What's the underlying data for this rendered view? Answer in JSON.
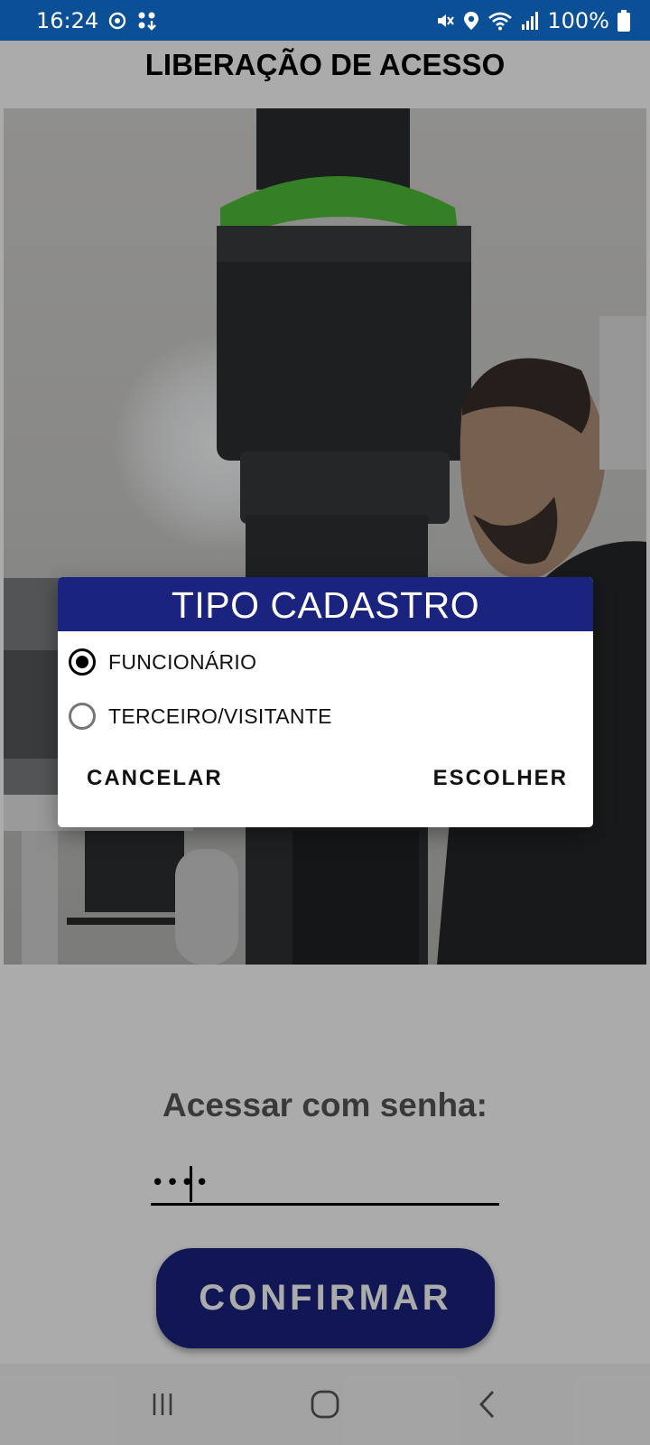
{
  "status_bar": {
    "time": "16:24",
    "battery_text": "100%",
    "icons": [
      "sync-icon",
      "apps-download-icon",
      "mute-icon",
      "location-icon",
      "wifi-icon",
      "signal-icon",
      "battery-icon"
    ]
  },
  "page": {
    "title": "LIBERAÇÃO DE ACESSO"
  },
  "camera": {
    "content": "live-camera-preview"
  },
  "password": {
    "label": "Acessar com senha:",
    "value": "••••"
  },
  "confirm_button": {
    "label": "CONFIRMAR"
  },
  "dialog": {
    "title": "TIPO CADASTRO",
    "options": [
      {
        "label": "FUNCIONÁRIO",
        "selected": true
      },
      {
        "label": "TERCEIRO/VISITANTE",
        "selected": false
      }
    ],
    "cancel_label": "CANCELAR",
    "confirm_label": "ESCOLHER"
  },
  "nav_bar": {
    "icons": [
      "recent-apps-icon",
      "home-icon",
      "back-icon"
    ]
  },
  "colors": {
    "status_bar": "#0b4f96",
    "accent": "#1a237e",
    "scrim": "rgba(0,0,0,0.33)"
  }
}
